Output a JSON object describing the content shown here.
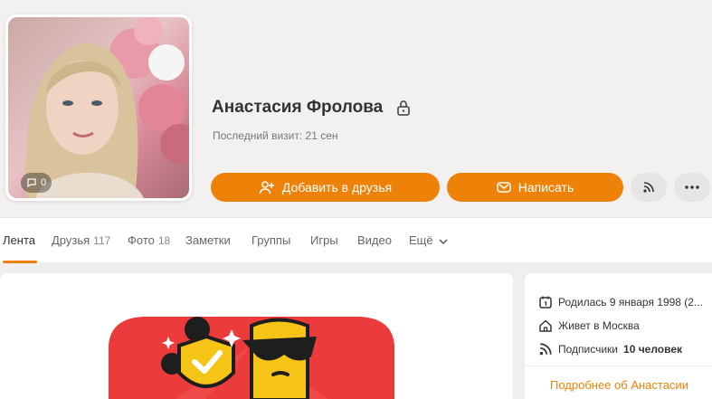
{
  "profile": {
    "name": "Анастасия Фролова",
    "last_visit": "Последний визит: 21 сен",
    "photo_comments": "0"
  },
  "actions": {
    "add_friend": "Добавить в друзья",
    "write": "Написать"
  },
  "nav": {
    "tabs": [
      {
        "label": "Лента",
        "count": ""
      },
      {
        "label": "Друзья",
        "count": "117"
      },
      {
        "label": "Фото",
        "count": "18"
      },
      {
        "label": "Заметки",
        "count": ""
      },
      {
        "label": "Группы",
        "count": ""
      },
      {
        "label": "Игры",
        "count": ""
      },
      {
        "label": "Видео",
        "count": ""
      },
      {
        "label": "Ещё",
        "count": ""
      }
    ],
    "active": "Лента"
  },
  "about": {
    "birthday": "Родилась 9 января 1998 (2...",
    "city": "Живет в Москва",
    "subscribers_label": "Подписчики",
    "subscribers_value": "10 человек",
    "more_link": "Подробнее об Анастасии"
  },
  "colors": {
    "accent": "#ee8208",
    "promo_red": "#ec3b3b",
    "promo_yellow": "#f6c416"
  },
  "icons": [
    "lock-icon",
    "add-friend-icon",
    "mail-icon",
    "rss-icon",
    "more-icon",
    "calendar-icon",
    "home-icon",
    "comment-icon",
    "chevron-down-icon"
  ]
}
